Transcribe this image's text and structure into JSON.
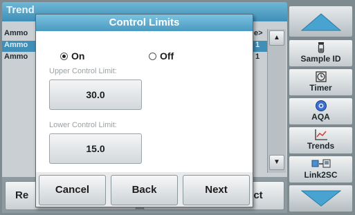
{
  "background": {
    "window_title": "Trend",
    "rows": [
      {
        "left": "Ammo",
        "right": "e>"
      },
      {
        "left": "Ammo",
        "right": "1"
      },
      {
        "left": "Ammo",
        "right": "1"
      }
    ],
    "selected_row": 1,
    "scroll_up_glyph": "▲",
    "scroll_down_glyph": "▼",
    "bottom_left_label": "Re",
    "bottom_right_label": "ect"
  },
  "sidebar": {
    "up_icon": "arrow-up-icon",
    "down_icon": "arrow-down-icon",
    "items": [
      {
        "label": "Sample ID",
        "icon": "sample-vial-icon"
      },
      {
        "label": "Timer",
        "icon": "timer-icon"
      },
      {
        "label": "AQA",
        "icon": "aqa-icon"
      },
      {
        "label": "Trends",
        "icon": "trends-chart-icon"
      },
      {
        "label": "Link2SC",
        "icon": "link2sc-icon"
      }
    ]
  },
  "dialog": {
    "title": "Control Limits",
    "radio_on_label": "On",
    "radio_off_label": "Off",
    "selected": "On",
    "upper_label": "Upper Control Limit:",
    "upper_value": "30.0",
    "lower_label": "Lower Control Limit:",
    "lower_value": "15.0",
    "cancel_label": "Cancel",
    "back_label": "Back",
    "next_label": "Next"
  },
  "colors": {
    "title_bar": "#4a9ac2",
    "selection": "#3f8fb8",
    "nav_arrow": "#4aa6d3"
  }
}
